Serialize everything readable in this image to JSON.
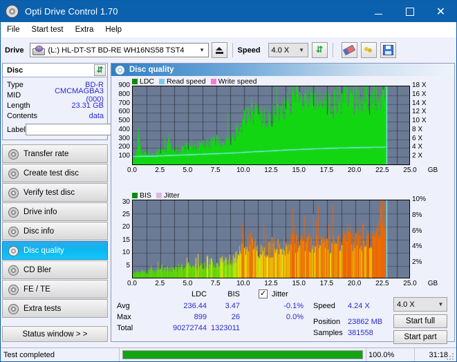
{
  "window": {
    "title": "Opti Drive Control 1.70",
    "icon": "disc-icon",
    "minimize": "−",
    "maximize": "□",
    "close": "✕"
  },
  "menu": [
    "File",
    "Start test",
    "Extra",
    "Help"
  ],
  "toolbar": {
    "drive_label": "Drive",
    "drive_value": "(L:)  HL-DT-ST BD-RE  WH16NS58 TST4",
    "eject_title": "eject-icon",
    "speed_label": "Speed",
    "speed_value": "4.0 X",
    "icons": [
      "refresh-icon",
      "eraser-icon",
      "keys-icon",
      "save-icon"
    ]
  },
  "disc_panel": {
    "title": "Disc",
    "refresh_icon": "refresh-icon",
    "rows": [
      {
        "key": "Type",
        "value": "BD-R"
      },
      {
        "key": "MID",
        "value": "CMCMAGBA3 (000)"
      },
      {
        "key": "Length",
        "value": "23.31 GB"
      },
      {
        "key": "Contents",
        "value": "data"
      }
    ],
    "label_key": "Label",
    "label_value": "",
    "label_placeholder": "",
    "cd_icon": "disc-icon"
  },
  "sidebar": {
    "items": [
      {
        "label": "Transfer rate",
        "active": false
      },
      {
        "label": "Create test disc",
        "active": false
      },
      {
        "label": "Verify test disc",
        "active": false
      },
      {
        "label": "Drive info",
        "active": false
      },
      {
        "label": "Disc info",
        "active": false
      },
      {
        "label": "Disc quality",
        "active": true
      },
      {
        "label": "CD Bler",
        "active": false
      },
      {
        "label": "FE / TE",
        "active": false
      },
      {
        "label": "Extra tests",
        "active": false
      }
    ],
    "status_button": "Status window > >"
  },
  "panel": {
    "title": "Disc quality",
    "icon": "disc-icon"
  },
  "chart_data": [
    {
      "type": "area",
      "name": "ldc-chart",
      "title": "",
      "xlabel": "GB",
      "ylabel": "",
      "xlim": [
        0,
        25
      ],
      "ylim": [
        0,
        900
      ],
      "y2lim": [
        0,
        18
      ],
      "y2label": "X",
      "xticks": [
        "0.0",
        "2.5",
        "5.0",
        "7.5",
        "10.0",
        "12.5",
        "15.0",
        "17.5",
        "20.0",
        "22.5",
        "25.0"
      ],
      "yticks": [
        100,
        200,
        300,
        400,
        500,
        600,
        700,
        800,
        900
      ],
      "y2ticks": [
        2,
        4,
        6,
        8,
        10,
        12,
        14,
        16,
        18
      ],
      "grid": true,
      "legend": [
        {
          "label": "LDC",
          "color": "#0a8a0a"
        },
        {
          "label": "Read speed",
          "color": "#7ec8f0"
        },
        {
          "label": "Write speed",
          "color": "#f878d8"
        }
      ],
      "data_end_gb": 22.85,
      "series": [
        {
          "name": "LDC",
          "color": "#12d612",
          "x": [
            0.0,
            0.25,
            0.5,
            0.75,
            1.0,
            1.25,
            1.5,
            1.75,
            2.0,
            2.25,
            2.5,
            2.75,
            3.0,
            3.25,
            3.5,
            3.75,
            4.0,
            4.25,
            4.5,
            4.75,
            5.0,
            5.25,
            5.5,
            5.75,
            6.0,
            6.25,
            6.5,
            6.75,
            7.0,
            7.25,
            7.5,
            7.75,
            8.0,
            8.25,
            8.5,
            8.75,
            9.0,
            9.25,
            9.5,
            9.75,
            10.0,
            10.25,
            10.5,
            10.75,
            11.0,
            11.25,
            11.5,
            11.75,
            12.0,
            12.25,
            12.5,
            12.75,
            13.0,
            13.25,
            13.5,
            13.75,
            14.0,
            14.25,
            14.5,
            14.75,
            15.0,
            15.25,
            15.5,
            15.75,
            16.0,
            16.25,
            16.5,
            16.75,
            17.0,
            17.25,
            17.5,
            17.75,
            18.0,
            18.25,
            18.5,
            18.75,
            19.0,
            19.25,
            19.5,
            19.75,
            20.0,
            20.25,
            20.5,
            20.75,
            21.0,
            21.25,
            21.5,
            21.75,
            22.0,
            22.25,
            22.5,
            22.75,
            22.85
          ],
          "values": [
            95,
            110,
            380,
            150,
            120,
            130,
            115,
            125,
            140,
            150,
            160,
            150,
            175,
            330,
            160,
            170,
            185,
            180,
            195,
            200,
            210,
            230,
            215,
            225,
            240,
            250,
            230,
            245,
            260,
            255,
            300,
            270,
            265,
            285,
            350,
            300,
            320,
            380,
            430,
            470,
            560,
            520,
            650,
            600,
            560,
            540,
            520,
            560,
            500,
            540,
            560,
            520,
            560,
            540,
            600,
            620,
            820,
            700,
            760,
            720,
            680,
            700,
            660,
            740,
            700,
            680,
            720,
            700,
            640,
            660,
            680,
            700,
            660,
            720,
            700,
            680,
            740,
            700,
            760,
            700,
            720,
            740,
            700,
            760,
            720,
            740,
            700,
            760,
            780,
            820,
            899,
            899,
            880
          ]
        },
        {
          "name": "Read speed",
          "color": "#7ce8f8",
          "x": [
            0.0,
            1.0,
            2.0,
            3.0,
            4.0,
            5.0,
            6.0,
            7.0,
            8.0,
            9.0,
            10.0,
            11.0,
            12.0,
            13.0,
            14.0,
            15.0,
            16.0,
            17.0,
            18.0,
            19.0,
            20.0,
            21.0,
            22.0,
            22.85
          ],
          "values": [
            2.1,
            2.15,
            2.2,
            2.3,
            2.4,
            2.5,
            2.6,
            2.7,
            2.8,
            2.9,
            3.05,
            3.2,
            3.3,
            3.45,
            3.6,
            3.7,
            3.8,
            3.9,
            4.0,
            4.05,
            4.1,
            4.15,
            4.2,
            4.24
          ]
        }
      ]
    },
    {
      "type": "bar",
      "name": "bis-chart",
      "title": "",
      "xlabel": "GB",
      "xlim": [
        0,
        25
      ],
      "ylim": [
        0,
        31
      ],
      "y2lim": [
        0,
        10
      ],
      "y2label": "%",
      "xticks": [
        "0.0",
        "2.5",
        "5.0",
        "7.5",
        "10.0",
        "12.5",
        "15.0",
        "17.5",
        "20.0",
        "22.5",
        "25.0"
      ],
      "yticks": [
        5,
        10,
        15,
        20,
        25,
        30
      ],
      "y2ticks": [
        "2%",
        "4%",
        "6%",
        "8%",
        "10%"
      ],
      "grid": true,
      "legend": [
        {
          "label": "BIS",
          "color": "#0a8a0a"
        },
        {
          "label": "Jitter",
          "color": "#d8b8e0"
        }
      ],
      "data_end_gb": 22.85,
      "series": [
        {
          "name": "BIS",
          "x": [
            0.0,
            0.25,
            0.5,
            0.75,
            1.0,
            1.25,
            1.5,
            1.75,
            2.0,
            2.25,
            2.5,
            2.75,
            3.0,
            3.25,
            3.5,
            3.75,
            4.0,
            4.25,
            4.5,
            4.75,
            5.0,
            5.25,
            5.5,
            5.75,
            6.0,
            6.25,
            6.5,
            6.75,
            7.0,
            7.25,
            7.5,
            7.75,
            8.0,
            8.25,
            8.5,
            8.75,
            9.0,
            9.25,
            9.5,
            9.75,
            10.0,
            10.25,
            10.5,
            10.75,
            11.0,
            11.25,
            11.5,
            11.75,
            12.0,
            12.25,
            12.5,
            12.75,
            13.0,
            13.25,
            13.5,
            13.75,
            14.0,
            14.25,
            14.5,
            14.75,
            15.0,
            15.25,
            15.5,
            15.75,
            16.0,
            16.25,
            16.5,
            16.75,
            17.0,
            17.25,
            17.5,
            17.75,
            18.0,
            18.25,
            18.5,
            18.75,
            19.0,
            19.25,
            19.5,
            19.75,
            20.0,
            20.25,
            20.5,
            20.75,
            21.0,
            21.25,
            21.5,
            21.75,
            22.0,
            22.25,
            22.5,
            22.75,
            22.85
          ],
          "values": [
            2,
            2.5,
            3,
            2.5,
            3,
            2.5,
            3,
            3.5,
            3,
            3.5,
            3,
            3.5,
            4,
            3.5,
            4,
            3.5,
            4,
            4.5,
            4,
            4.5,
            5,
            4.5,
            5,
            4.5,
            5,
            5.5,
            5,
            5.5,
            6,
            5.5,
            6,
            6.5,
            6,
            7,
            6.5,
            7,
            7.5,
            8,
            9,
            10,
            12,
            11,
            14,
            13,
            12,
            11,
            10,
            11,
            10,
            11,
            12,
            11,
            12,
            11,
            13,
            12,
            14,
            13,
            15,
            13,
            12,
            13,
            12,
            14,
            13,
            12,
            14,
            13,
            12,
            13,
            14,
            13,
            15,
            14,
            13,
            16,
            14,
            17,
            15,
            14,
            16,
            15,
            14,
            17,
            15,
            16,
            15,
            18,
            20,
            24,
            26,
            22
          ]
        }
      ]
    }
  ],
  "stats": {
    "columns": [
      "LDC",
      "BIS",
      "Jitter"
    ],
    "jitter_checked": true,
    "jitter_check_glyph": "✓",
    "rows": [
      {
        "label": "Avg",
        "ldc": "236.44",
        "bis": "3.47",
        "jitter": "-0.1%"
      },
      {
        "label": "Max",
        "ldc": "899",
        "bis": "26",
        "jitter": "0.0%"
      },
      {
        "label": "Total",
        "ldc": "90272744",
        "bis": "1323011",
        "jitter": ""
      }
    ]
  },
  "controls": {
    "speed_label": "Speed",
    "speed_value": "4.24 X",
    "speed_select": "4.0 X",
    "position_label": "Position",
    "position_value": "23862 MB",
    "samples_label": "Samples",
    "samples_value": "381558",
    "start_full": "Start full",
    "start_part": "Start part"
  },
  "statusbar": {
    "text": "Test completed",
    "progress_percent": 100.0,
    "percent_label": "100.0%",
    "time": "31:18"
  }
}
